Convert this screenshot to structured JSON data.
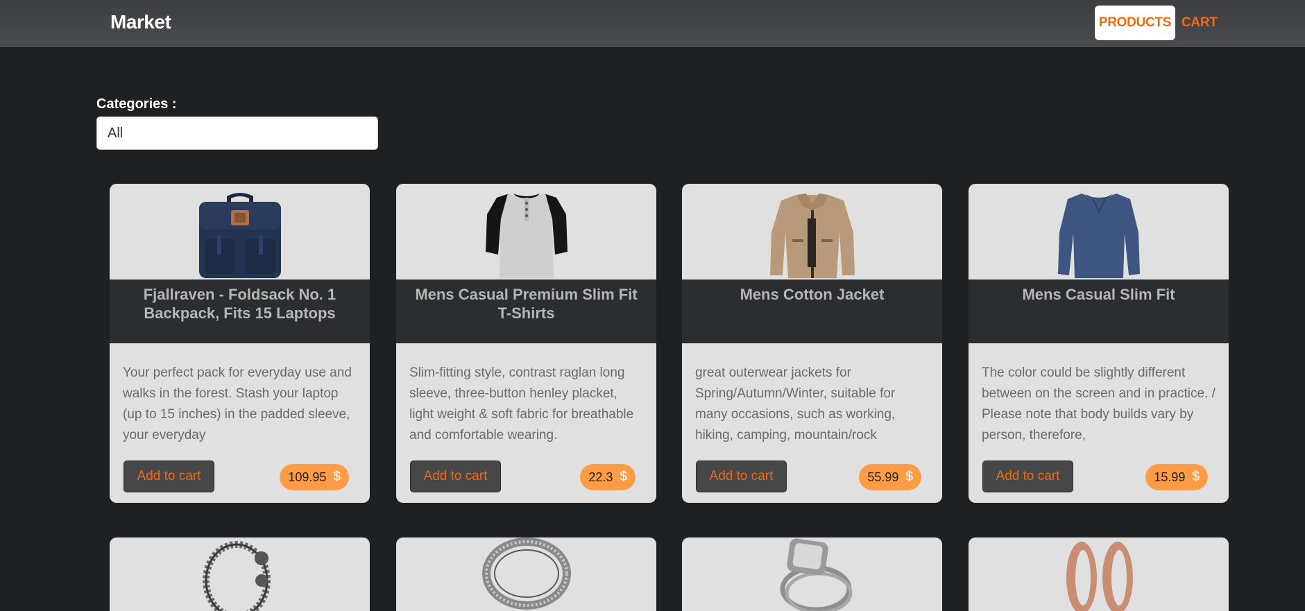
{
  "header": {
    "brand": "Market",
    "nav": {
      "products": "PRODUCTS",
      "cart": "CART"
    }
  },
  "filter": {
    "label": "Categories :",
    "selected": "All"
  },
  "products": [
    {
      "title": "Fjallraven - Foldsack No. 1 Backpack, Fits 15 Laptops",
      "description": "Your perfect pack for everyday use and walks in the forest. Stash your laptop (up to 15 inches) in the padded sleeve, your everyday",
      "button": "Add to cart",
      "price": "109.95",
      "currency": "$",
      "icon": "backpack-icon"
    },
    {
      "title": "Mens Casual Premium Slim Fit T-Shirts",
      "description": "Slim-fitting style, contrast raglan long sleeve, three-button henley placket, light weight & soft fabric for breathable and comfortable wearing.",
      "button": "Add to cart",
      "price": "22.3",
      "currency": "$",
      "icon": "tshirt-icon"
    },
    {
      "title": "Mens Cotton Jacket",
      "description": "great outerwear jackets for Spring/Autumn/Winter, suitable for many occasions, such as working, hiking, camping, mountain/rock",
      "button": "Add to cart",
      "price": "55.99",
      "currency": "$",
      "icon": "jacket-icon"
    },
    {
      "title": "Mens Casual Slim Fit",
      "description": "The color could be slightly different between on the screen and in practice. / Please note that body builds vary by person, therefore,",
      "button": "Add to cart",
      "price": "15.99",
      "currency": "$",
      "icon": "long-sleeve-shirt-icon"
    }
  ],
  "partial_products": [
    {
      "icon": "bracelet-icon"
    },
    {
      "icon": "ring-icon"
    },
    {
      "icon": "diamond-ring-icon"
    },
    {
      "icon": "earrings-icon"
    }
  ]
}
